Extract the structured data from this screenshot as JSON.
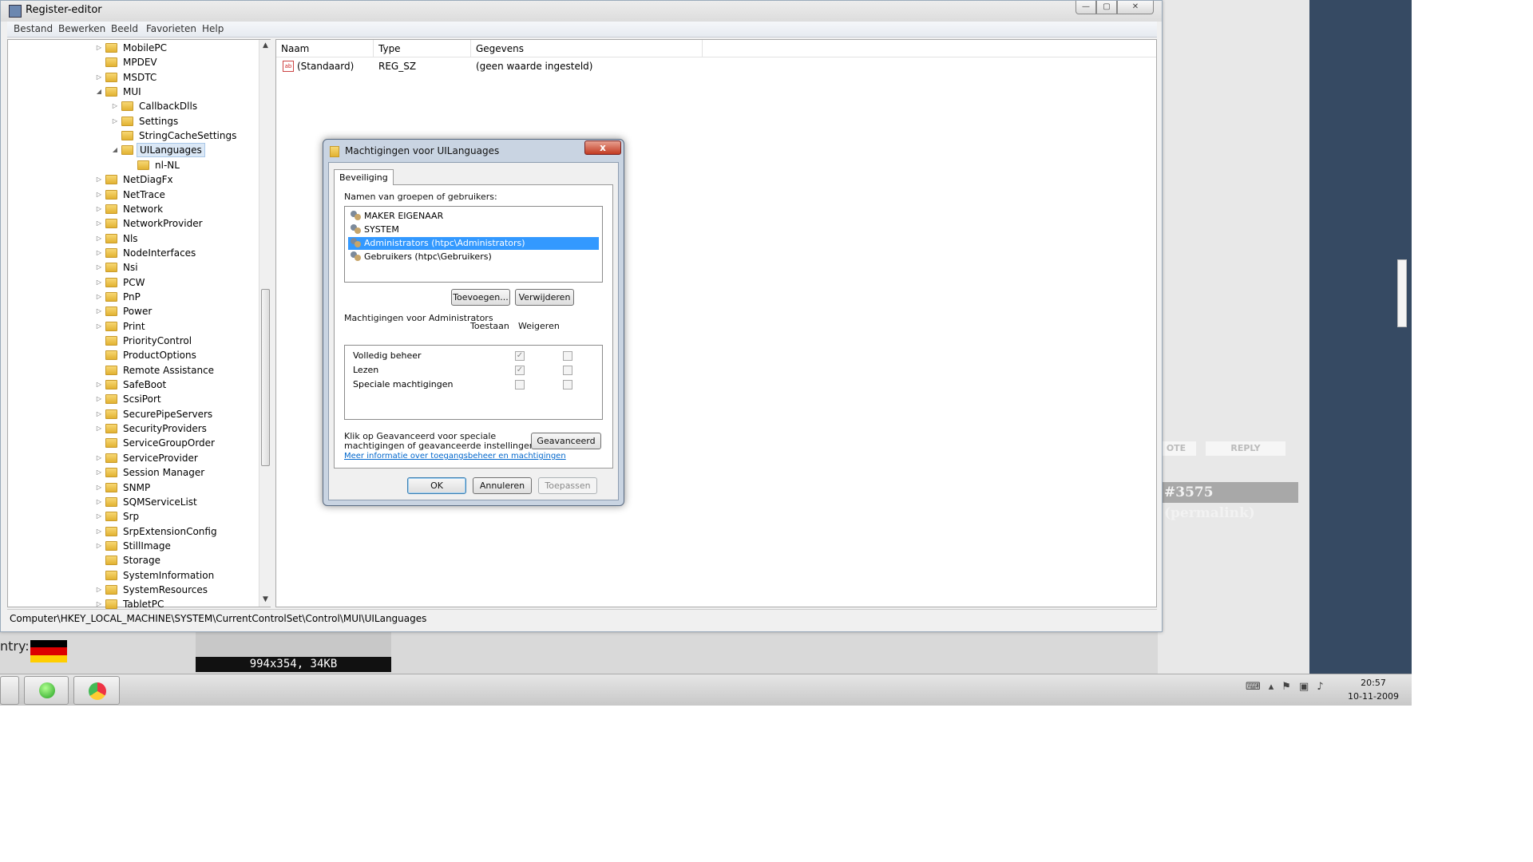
{
  "regedit": {
    "title": "Register-editor",
    "menu": [
      "Bestand",
      "Bewerken",
      "Beeld",
      "Favorieten",
      "Help"
    ],
    "tree": [
      {
        "label": "MobilePC",
        "level": 0,
        "exp": "closed"
      },
      {
        "label": "MPDEV",
        "level": 0,
        "exp": "none"
      },
      {
        "label": "MSDTC",
        "level": 0,
        "exp": "closed"
      },
      {
        "label": "MUI",
        "level": 0,
        "exp": "open"
      },
      {
        "label": "CallbackDlls",
        "level": 1,
        "exp": "closed"
      },
      {
        "label": "Settings",
        "level": 1,
        "exp": "closed"
      },
      {
        "label": "StringCacheSettings",
        "level": 1,
        "exp": "none"
      },
      {
        "label": "UILanguages",
        "level": 1,
        "exp": "open",
        "selected": true
      },
      {
        "label": "nl-NL",
        "level": 2,
        "exp": "none"
      },
      {
        "label": "NetDiagFx",
        "level": 0,
        "exp": "closed"
      },
      {
        "label": "NetTrace",
        "level": 0,
        "exp": "closed"
      },
      {
        "label": "Network",
        "level": 0,
        "exp": "closed"
      },
      {
        "label": "NetworkProvider",
        "level": 0,
        "exp": "closed"
      },
      {
        "label": "Nls",
        "level": 0,
        "exp": "closed"
      },
      {
        "label": "NodeInterfaces",
        "level": 0,
        "exp": "closed"
      },
      {
        "label": "Nsi",
        "level": 0,
        "exp": "closed"
      },
      {
        "label": "PCW",
        "level": 0,
        "exp": "closed"
      },
      {
        "label": "PnP",
        "level": 0,
        "exp": "closed"
      },
      {
        "label": "Power",
        "level": 0,
        "exp": "closed"
      },
      {
        "label": "Print",
        "level": 0,
        "exp": "closed"
      },
      {
        "label": "PriorityControl",
        "level": 0,
        "exp": "none"
      },
      {
        "label": "ProductOptions",
        "level": 0,
        "exp": "none"
      },
      {
        "label": "Remote Assistance",
        "level": 0,
        "exp": "none"
      },
      {
        "label": "SafeBoot",
        "level": 0,
        "exp": "closed"
      },
      {
        "label": "ScsiPort",
        "level": 0,
        "exp": "closed"
      },
      {
        "label": "SecurePipeServers",
        "level": 0,
        "exp": "closed"
      },
      {
        "label": "SecurityProviders",
        "level": 0,
        "exp": "closed"
      },
      {
        "label": "ServiceGroupOrder",
        "level": 0,
        "exp": "none"
      },
      {
        "label": "ServiceProvider",
        "level": 0,
        "exp": "closed"
      },
      {
        "label": "Session Manager",
        "level": 0,
        "exp": "closed"
      },
      {
        "label": "SNMP",
        "level": 0,
        "exp": "closed"
      },
      {
        "label": "SQMServiceList",
        "level": 0,
        "exp": "closed"
      },
      {
        "label": "Srp",
        "level": 0,
        "exp": "closed"
      },
      {
        "label": "SrpExtensionConfig",
        "level": 0,
        "exp": "closed"
      },
      {
        "label": "StillImage",
        "level": 0,
        "exp": "closed"
      },
      {
        "label": "Storage",
        "level": 0,
        "exp": "none"
      },
      {
        "label": "SystemInformation",
        "level": 0,
        "exp": "none"
      },
      {
        "label": "SystemResources",
        "level": 0,
        "exp": "closed"
      },
      {
        "label": "TabletPC",
        "level": 0,
        "exp": "closed"
      }
    ],
    "columns": {
      "name": "Naam",
      "type": "Type",
      "data": "Gegevens"
    },
    "values": [
      {
        "name": "(Standaard)",
        "type": "REG_SZ",
        "data": "(geen waarde ingesteld)"
      }
    ],
    "value_icon": "ab",
    "status_path": "Computer\\HKEY_LOCAL_MACHINE\\SYSTEM\\CurrentControlSet\\Control\\MUI\\UILanguages"
  },
  "dialog": {
    "title": "Machtigingen voor UILanguages",
    "close_label": "x",
    "tab": "Beveiliging",
    "users_label": "Namen van groepen of gebruikers:",
    "users": [
      {
        "name": "MAKER EIGENAAR"
      },
      {
        "name": "SYSTEM"
      },
      {
        "name": "Administrators (htpc\\Administrators)",
        "selected": true
      },
      {
        "name": "Gebruikers (htpc\\Gebruikers)"
      }
    ],
    "add_button": "Toevoegen...",
    "remove_button": "Verwijderen",
    "perms_label": "Machtigingen voor Administrators",
    "allow_header": "Toestaan",
    "deny_header": "Weigeren",
    "permissions": [
      {
        "name": "Volledig beheer",
        "allow": true,
        "deny": false
      },
      {
        "name": "Lezen",
        "allow": true,
        "deny": false
      },
      {
        "name": "Speciale machtigingen",
        "allow": false,
        "deny": false
      }
    ],
    "advanced_text_1": "Klik op Geavanceerd voor speciale",
    "advanced_text_2": "machtigingen of geavanceerde instellingen.",
    "advanced_button": "Geavanceerd",
    "link": "Meer informatie over toegangsbeheer en machtigingen",
    "ok": "OK",
    "cancel": "Annuleren",
    "apply": "Toepassen"
  },
  "background": {
    "vote_label": "OTE",
    "reply_label": "REPLY",
    "permalink": "#3575 (permalink)",
    "country_label": "ntry:",
    "thumb_label": "994x354, 34KB",
    "flag_colors": [
      "#000000",
      "#dd0000",
      "#ffce00"
    ]
  },
  "taskbar": {
    "time": "20:57",
    "date": "10-11-2009"
  }
}
